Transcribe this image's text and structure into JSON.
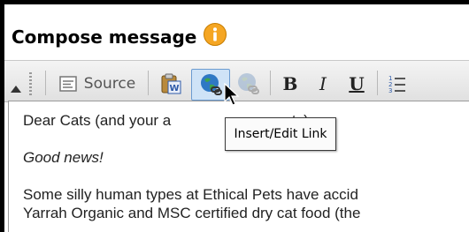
{
  "compose": {
    "heading": "Compose message",
    "info_icon": "info-circle-icon"
  },
  "toolbar": {
    "source_label": "Source",
    "bold_label": "B",
    "italic_label": "I",
    "underline_label": "U",
    "icons": [
      "collapse-toolbar-icon",
      "source-icon",
      "paste-from-word-icon",
      "insert-link-icon",
      "unlink-icon",
      "numbered-list-icon"
    ],
    "active_button": "Insert/Edit Link"
  },
  "tooltip": {
    "text": "Insert/Edit Link"
  },
  "editor": {
    "para1_before": "Dear Cats (and your a",
    "para1_after": "an servants)",
    "para2": "Good news!",
    "para3": "Some silly human types at Ethical Pets have accid",
    "para4": "Yarrah Organic and MSC certified dry cat food (the"
  },
  "colors": {
    "info_icon": "#f5a623",
    "active_button_bg": "#cfe3f7",
    "active_button_border": "#6b9bd1"
  }
}
